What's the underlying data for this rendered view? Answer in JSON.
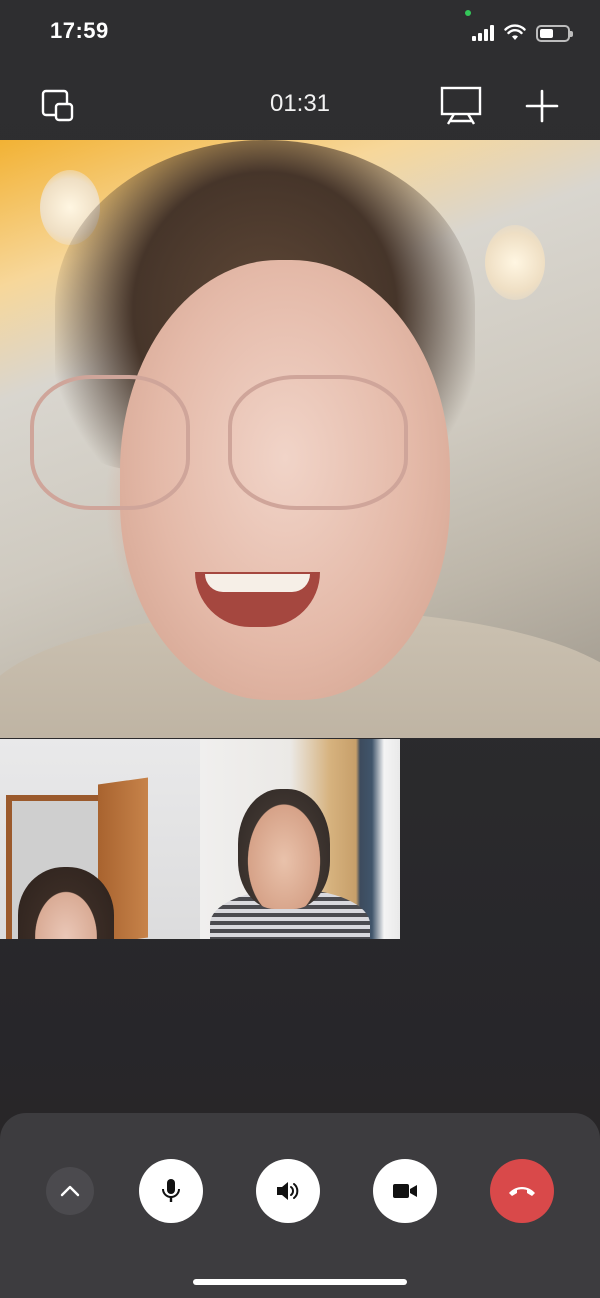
{
  "status_bar": {
    "time": "17:59",
    "icons": [
      "cellular-signal-icon",
      "wifi-icon",
      "battery-icon"
    ],
    "battery_level": 0.45,
    "privacy_indicator_color": "#34c759"
  },
  "toolbar": {
    "left_icon": "minimize-window-icon",
    "timer": "01:31",
    "right_icons": [
      "screen-share-icon",
      "add-participant-icon"
    ]
  },
  "videos": {
    "main": "active-speaker-video",
    "thumbnails": [
      "participant-video-1",
      "participant-video-2"
    ]
  },
  "controls": {
    "buttons": [
      "expand-panel",
      "microphone",
      "speaker",
      "camera",
      "end-call"
    ],
    "end_call_color": "#d9494a"
  }
}
